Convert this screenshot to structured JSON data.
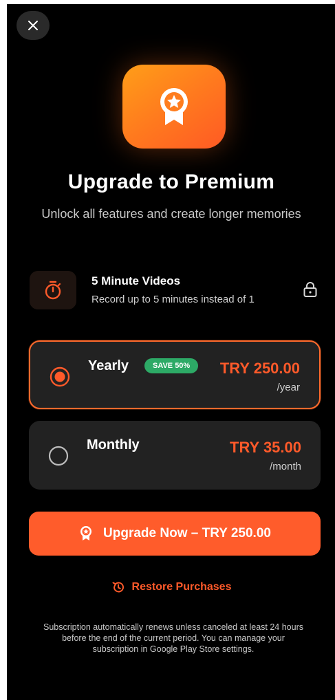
{
  "header": {
    "close_icon": "close-icon"
  },
  "hero": {
    "icon": "award-badge-icon",
    "title": "Upgrade to Premium",
    "subtitle": "Unlock all features and create longer memories"
  },
  "feature": {
    "icon": "stopwatch-icon",
    "title": "5 Minute Videos",
    "description": "Record up to 5 minutes instead of 1",
    "status_icon": "lock-icon"
  },
  "plans": [
    {
      "name": "Yearly",
      "badge": "SAVE 50%",
      "price": "TRY 250.00",
      "period": "/year",
      "selected": true
    },
    {
      "name": "Monthly",
      "price": "TRY 35.00",
      "period": "/month",
      "selected": false
    }
  ],
  "cta": {
    "icon": "award-badge-icon",
    "label": "Upgrade Now – TRY 250.00"
  },
  "restore": {
    "icon": "history-icon",
    "label": "Restore Purchases"
  },
  "footer": {
    "text": "Subscription automatically renews unless canceled at least 24 hours before the end of the current period. You can manage your subscription in Google Play Store settings."
  },
  "colors": {
    "background": "#000000",
    "accent": "#ff5c2b",
    "card": "#222222",
    "badge": "#2daa66"
  }
}
